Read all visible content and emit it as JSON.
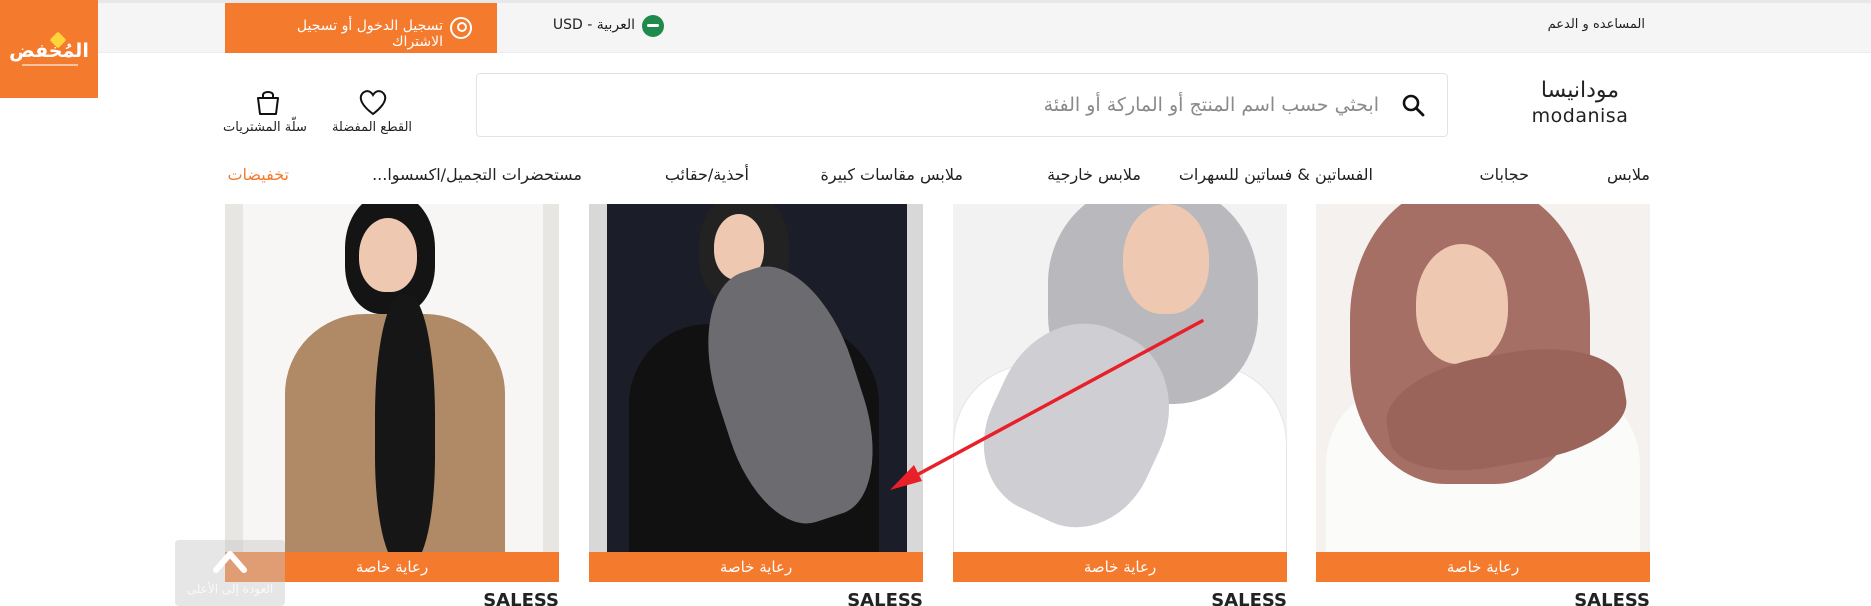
{
  "header": {
    "help_link": "المساعده و الدعم",
    "language_label": "العربية - USD",
    "login_label": "تسجيل الدخول أو تسجيل الاشتراك"
  },
  "logo_badge": {
    "text": "المُخفض"
  },
  "brand": {
    "arabic": "مودانيسا",
    "latin": "modanisa"
  },
  "search": {
    "placeholder": "ابحثي حسب اسم المنتج أو الماركة أو الفئة"
  },
  "actions": {
    "favorites_label": "القطع المفضلة",
    "cart_label": "سلّة المشتريات"
  },
  "nav": {
    "items": [
      "ملابس",
      "حجابات",
      "الفساتين & فساتين للسهرات",
      "ملابس خارجية",
      "ملابس مقاسات كبيرة",
      "أحذية/حقائب",
      "مستحضرات التجميل/اكسسوا...",
      "تخفيضات"
    ]
  },
  "products": [
    {
      "badge": "رعاية خاصة",
      "brand": "SALESS"
    },
    {
      "badge": "رعاية خاصة",
      "brand": "SALESS"
    },
    {
      "badge": "رعاية خاصة",
      "brand": "SALESS"
    },
    {
      "badge": "رعاية خاصة",
      "brand": "SALESS"
    }
  ],
  "scroll_top": {
    "label": "العودة إلى الأعلى"
  },
  "colors": {
    "accent": "#f47a2e",
    "arrow": "#e8202a",
    "flag": "#1e8a4b"
  },
  "icons": [
    "user-icon",
    "search-icon",
    "heart-icon",
    "bag-icon",
    "up-arrow-icon",
    "flag-icon"
  ]
}
